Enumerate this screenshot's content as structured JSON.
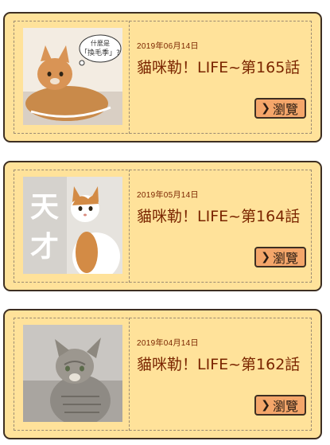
{
  "articles": [
    {
      "date": "2019年06月14日",
      "title": "貓咪勒！LIFE~第165話",
      "button_label": "瀏覽",
      "thumb_bubble_line1": "什麼是",
      "thumb_bubble_line2": "「換毛季」?",
      "thumb_desc": "orange tabby cat lying with thought bubble"
    },
    {
      "date": "2019年05月14日",
      "title": "貓咪勒！LIFE~第164話",
      "button_label": "瀏覽",
      "thumb_big_text_1": "天",
      "thumb_big_text_2": "才",
      "thumb_desc": "white and orange cat sitting"
    },
    {
      "date": "2019年04月14日",
      "title": "貓咪勒！LIFE~第162話",
      "button_label": "瀏覽",
      "thumb_desc": "grey tabby cat looking up"
    }
  ],
  "icons": {
    "button": "chevron-right-icon"
  },
  "colors": {
    "card_bg": "#ffe29a",
    "button_bg": "#f4a66a",
    "text": "#7a2500"
  }
}
